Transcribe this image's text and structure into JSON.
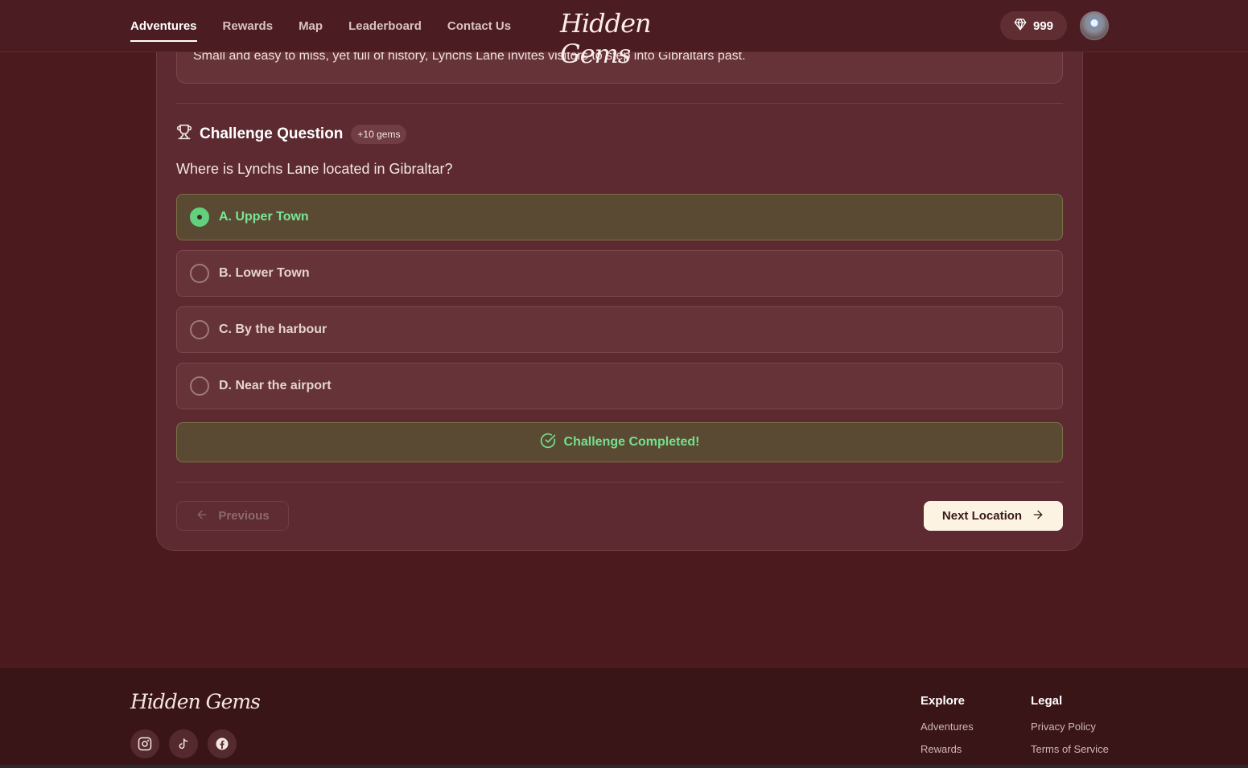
{
  "header": {
    "nav": [
      "Adventures",
      "Rewards",
      "Map",
      "Leaderboard",
      "Contact Us"
    ],
    "logo": "Hidden Gems",
    "gems": "999"
  },
  "card": {
    "description": "Small and easy to miss, yet full of history, Lynchs Lane invites visitors to step into Gibraltars past.",
    "challenge_title": "Challenge Question",
    "badge": "+10 gems",
    "question": "Where is Lynchs Lane located in Gibraltar?",
    "options": [
      {
        "label": "A. Upper Town",
        "selected": true
      },
      {
        "label": "B. Lower Town",
        "selected": false
      },
      {
        "label": "C. By the harbour",
        "selected": false
      },
      {
        "label": "D. Near the airport",
        "selected": false
      }
    ],
    "completed_label": "Challenge Completed!",
    "previous_label": "Previous",
    "next_label": "Next Location"
  },
  "footer": {
    "logo": "Hidden Gems",
    "explore_title": "Explore",
    "explore_links": [
      "Adventures",
      "Rewards"
    ],
    "legal_title": "Legal",
    "legal_links": [
      "Privacy Policy",
      "Terms of Service"
    ]
  },
  "colors": {
    "background": "#4a1a1f",
    "accent_green": "#63d07e",
    "next_button": "#fdf3e3"
  },
  "icons": [
    "diamond-icon",
    "trophy-icon",
    "check-circle-icon",
    "arrow-left-icon",
    "arrow-right-icon",
    "instagram-icon",
    "tiktok-icon",
    "facebook-icon"
  ]
}
